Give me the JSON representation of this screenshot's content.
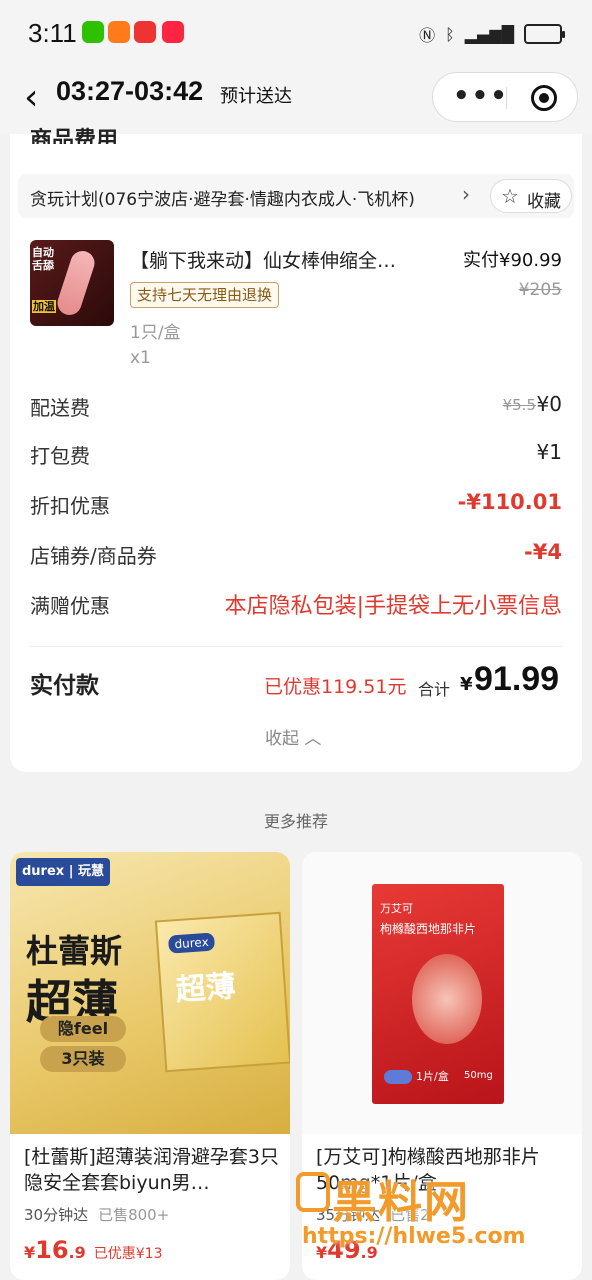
{
  "status_bar": {
    "time": "3:11",
    "apps": [
      "wechat",
      "app-orange",
      "toutiao",
      "xiaohongshu"
    ],
    "icons": [
      "nfc-icon",
      "bluetooth-icon",
      "signal-icon",
      "battery-icon"
    ]
  },
  "header": {
    "delivery_time": "03:27-03:42",
    "delivery_label": "预计送达"
  },
  "section": {
    "title": "商品费用"
  },
  "store": {
    "name": "贪玩计划(076宁波店·避孕套·情趣内衣成人·飞机杯)",
    "fav_label": "收藏"
  },
  "product": {
    "name": "【躺下我来动】仙女棒伸缩全…",
    "paid_price": "实付¥90.99",
    "original_price": "¥205",
    "badge": "支持七天无理由退换",
    "spec": "1只/盒",
    "qty": "x1",
    "image_tag_top": "自动舌舔",
    "image_tag_bottom": "加温"
  },
  "fees": [
    {
      "label": "配送费",
      "strike": "¥5.5",
      "value": "¥0"
    },
    {
      "label": "打包费",
      "value": "¥1"
    },
    {
      "label": "折扣优惠",
      "value": "-¥110.01"
    },
    {
      "label": "店铺券/商品券",
      "value": "-¥4"
    },
    {
      "label": "满赠优惠",
      "value": "本店隐私包装|手提袋上无小票信息"
    }
  ],
  "summary": {
    "label": "实付款",
    "saved": "已优惠119.51元",
    "total_label": "合计",
    "currency": "¥",
    "total": "91.99",
    "collapse": "收起"
  },
  "more": {
    "title": "更多推荐"
  },
  "recommend": [
    {
      "title": "[杜蕾斯]超薄装润滑避孕套3只隐安全套套biyun男…",
      "delivery": "30分钟达",
      "sold": "已售800+",
      "price_cur": "¥",
      "price_int": "16",
      "price_dec": ".9",
      "discount": "已优惠¥13",
      "img_brand": "durex | 玩慧",
      "img_line1": "杜蕾斯",
      "img_line2": "超薄",
      "img_pill1": "隐feel",
      "img_pill2": "3只装",
      "img_box": "超薄"
    },
    {
      "title": "[万艾可]枸橼酸西地那非片50mg*1片/盒",
      "delivery": "35分钟达",
      "sold": "已售2",
      "price_cur": "¥",
      "price_int": "49",
      "price_dec": ".9",
      "img_brand": "万艾可",
      "img_name": "枸橼酸西地那非片",
      "img_count": "1片/盒",
      "img_mg": "50mg"
    }
  ],
  "watermark": {
    "text": "黑料网",
    "url": "https://hlwe5.com"
  },
  "colors": {
    "accent_red": "#e03a2f",
    "badge_gold": "#c8a165"
  }
}
